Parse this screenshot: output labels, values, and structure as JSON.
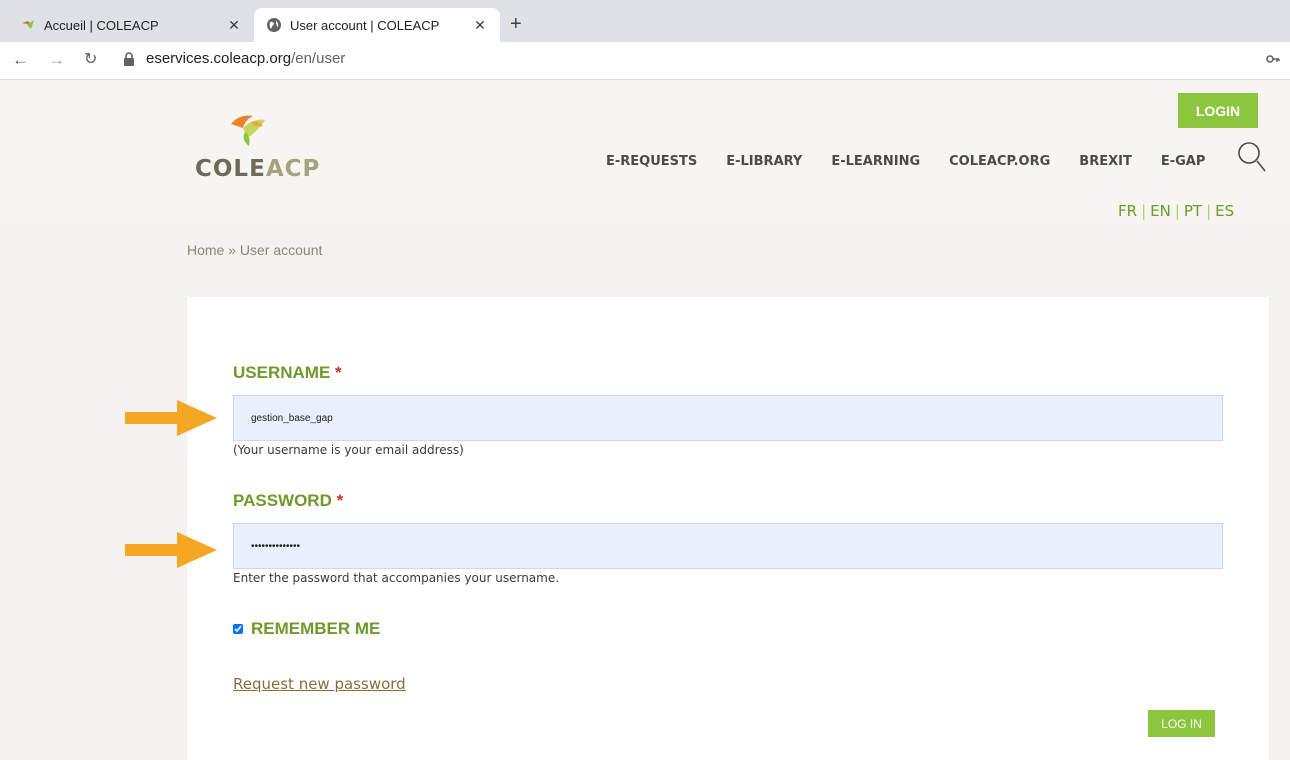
{
  "browser": {
    "tabs": [
      {
        "title": "Accueil | COLEACP",
        "active": false
      },
      {
        "title": "User account | COLEACP",
        "active": true
      }
    ],
    "url_host": "eservices.coleacp.org",
    "url_path": "/en/user"
  },
  "site": {
    "logo_cole": "COLE",
    "logo_acp": "ACP",
    "login_label": "LOGIN",
    "nav": [
      "E-REQUESTS",
      "E-LIBRARY",
      "E-LEARNING",
      "COLEACP.ORG",
      "BREXIT",
      "E-GAP"
    ],
    "languages": [
      "FR",
      "EN",
      "PT",
      "ES"
    ],
    "breadcrumb": "Home » User account"
  },
  "form": {
    "username_label": "USERNAME",
    "required_mark": "*",
    "username_value": "gestion_base_gap",
    "username_help": "(Your username is your email address)",
    "password_label": "PASSWORD",
    "password_value": "••••••••••••••",
    "password_help": "Enter the password that accompanies your username.",
    "remember_label": "REMEMBER ME",
    "remember_checked": true,
    "request_password": "Request new password",
    "submit_label": "LOG IN"
  },
  "colors": {
    "brand_green": "#8cc63f",
    "label_green": "#6d9a2a",
    "arrow_orange": "#f5a623"
  }
}
